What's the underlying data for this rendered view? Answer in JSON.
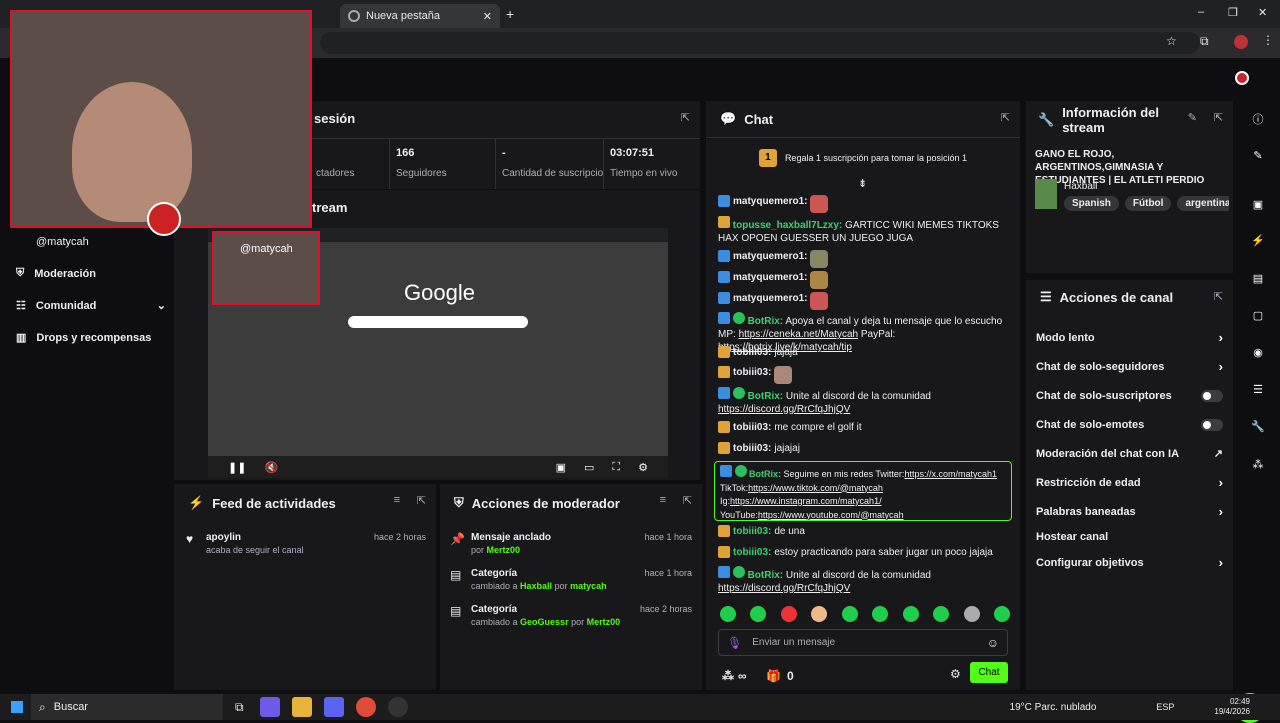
{
  "browser": {
    "tabs": [
      {
        "label": "Nueva pestaña"
      }
    ],
    "new_tab": "+",
    "win_min": "–",
    "win_max": "❐",
    "win_close": "✕"
  },
  "webcam": {
    "overlay_handle": "@matycah",
    "tiktok_handle": "@matycah"
  },
  "sidebar": {
    "items": [
      {
        "label": "Moderación"
      },
      {
        "label": "Comunidad"
      },
      {
        "label": "Drops y recompensas"
      }
    ]
  },
  "session": {
    "title": "sesión",
    "stats": [
      {
        "value": "",
        "label": "ctadores"
      },
      {
        "value": "166",
        "label": "Seguidores"
      },
      {
        "value": "-",
        "label": "Cantidad de suscripciones"
      },
      {
        "value": "03:07:51",
        "label": "Tiempo en vivo"
      }
    ],
    "stream_label": "tream"
  },
  "preview": {
    "google_text": "Google"
  },
  "activity": {
    "title": "Feed de actividades",
    "items": [
      {
        "user": "apoylin",
        "text": "acaba de seguir el canal",
        "time": "hace 2 horas"
      }
    ]
  },
  "modactions": {
    "title": "Acciones de moderador",
    "items": [
      {
        "title": "Mensaje anclado",
        "sub_prefix": "por",
        "target": "Mertz00",
        "by_prefix": "",
        "by": "",
        "time": "hace 1 hora"
      },
      {
        "title": "Categoría",
        "sub_prefix": "cambiado a",
        "target": "Haxball",
        "by_prefix": "por",
        "by": "matycah",
        "time": "hace 1 hora"
      },
      {
        "title": "Categoría",
        "sub_prefix": "cambiado a",
        "target": "GeoGuessr",
        "by_prefix": "por",
        "by": "Mertz00",
        "time": "hace 2 horas"
      }
    ]
  },
  "chat": {
    "title": "Chat",
    "gift_rank": "1",
    "gift_text": "Regala 1 suscripción para tomar la posición 1",
    "input_placeholder": "Enviar un mensaje",
    "points": "∞",
    "gift_count": "0",
    "send_label": "Chat",
    "messages": [
      {
        "user": "matyquemero1:",
        "text": "",
        "color": "#efeff1"
      },
      {
        "user": "topusse_haxball7Lzxy:",
        "text": "GARTICC WIKI MEMES TIKTOKS HAX OPOEN GUESSER UN JUEGO JUGA",
        "color": "#3fd16b"
      },
      {
        "user": "matyquemero1:",
        "text": "",
        "color": "#efeff1"
      },
      {
        "user": "matyquemero1:",
        "text": "",
        "color": "#efeff1"
      },
      {
        "user": "matyquemero1:",
        "text": "",
        "color": "#efeff1"
      },
      {
        "user": "BotRix:",
        "text": "Apoya el canal y deja tu mensaje que lo escucho MP:",
        "link1": "https://ceneka.net/Matycah",
        "mid": " PayPal: ",
        "link2": "https://botrix.live/k/matycah/tip",
        "color": "#3fd16b"
      },
      {
        "user": "tobiii03:",
        "text": "jajaja",
        "color": "#efeff1"
      },
      {
        "user": "tobiii03:",
        "text": "",
        "color": "#efeff1"
      },
      {
        "user": "BotRix:",
        "text": "Unite al discord de la comunidad",
        "link1": "https://discord.gg/RrCfqJhjQV",
        "color": "#3fd16b"
      },
      {
        "user": "tobiii03:",
        "text": "me compre el golf it",
        "color": "#efeff1"
      },
      {
        "user": "tobiii03:",
        "text": "jajajaj",
        "color": "#efeff1"
      }
    ],
    "pinned": {
      "user": "BotRix:",
      "text": "Seguime en mis redes Twitter:",
      "l1": "https://x.com/matycah1",
      "t2": "TikTok:",
      "l2": "https://www.tiktok.com/@matycah",
      "t3": "Ig:",
      "l3": "https://www.instagram.com/matycah1/",
      "t4": "YouTube:",
      "l4": "https://www.youtube.com/@matycah"
    },
    "after": [
      {
        "user": "tobiii03:",
        "text": "de una"
      },
      {
        "user": "tobiii03:",
        "text": "estoy practicando para saber jugar un poco jajaja"
      },
      {
        "user": "BotRix:",
        "text": "Unite al discord de la comunidad",
        "link1": "https://discord.gg/RrCfqJhjQV"
      }
    ]
  },
  "info": {
    "title": "Información del stream",
    "stream_title": "GANO EL ROJO, ARGENTINOS,GIMNASIA Y ESTUDIANTES | EL ATLETI PERDIO LA...",
    "category": "Haxball",
    "tags": [
      "Spanish",
      "Fútbol",
      "argentina",
      "g"
    ]
  },
  "channel_actions": {
    "title": "Acciones de canal",
    "rows": [
      {
        "label": "Modo lento",
        "type": "chev"
      },
      {
        "label": "Chat de solo-seguidores",
        "type": "chev"
      },
      {
        "label": "Chat de solo-suscriptores",
        "type": "toggle"
      },
      {
        "label": "Chat de solo-emotes",
        "type": "toggle"
      },
      {
        "label": "Moderación del chat con IA",
        "type": "ext"
      },
      {
        "label": "Restricción de edad",
        "type": "chev"
      },
      {
        "label": "Palabras baneadas",
        "type": "chev"
      },
      {
        "label": "Hostear canal",
        "type": "none"
      },
      {
        "label": "Configurar objetivos",
        "type": "chev"
      }
    ]
  },
  "taskbar": {
    "search": "Buscar",
    "weather": "19°C  Parc. nublado",
    "lang": "ESP",
    "time": "02:49",
    "date": "19/4/2026"
  }
}
